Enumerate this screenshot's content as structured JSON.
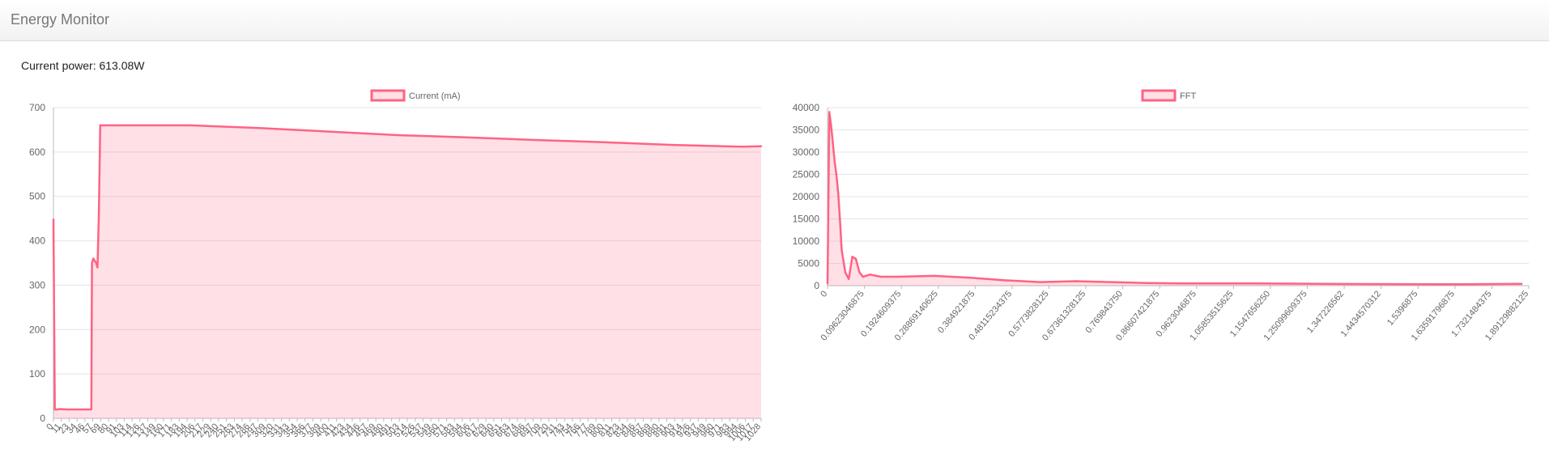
{
  "header": {
    "title": "Energy Monitor"
  },
  "status": {
    "current_power": "Current power: 613.08W"
  },
  "colors": {
    "series": "#ff6384",
    "series_fill": "rgba(255,99,132,0.2)",
    "grid": "#e5e5e5",
    "tick": "#666666"
  },
  "chart_data": [
    {
      "type": "line",
      "legend": "Current (mA)",
      "legend_position": "top",
      "ylim": [
        0,
        700
      ],
      "yticks": [
        0,
        100,
        200,
        300,
        400,
        500,
        600,
        700
      ],
      "xlim": [
        0,
        1028
      ],
      "xticks": [
        "0",
        "11",
        "23",
        "34",
        "46",
        "57",
        "69",
        "80",
        "91",
        "103",
        "114",
        "126",
        "137",
        "149",
        "160",
        "171",
        "183",
        "194",
        "206",
        "217",
        "229",
        "240",
        "251",
        "263",
        "274",
        "286",
        "297",
        "309",
        "320",
        "331",
        "343",
        "354",
        "366",
        "377",
        "389",
        "400",
        "411",
        "423",
        "434",
        "446",
        "457",
        "469",
        "480",
        "491",
        "503",
        "514",
        "526",
        "537",
        "549",
        "560",
        "571",
        "583",
        "594",
        "606",
        "617",
        "629",
        "640",
        "651",
        "663",
        "674",
        "686",
        "697",
        "709",
        "720",
        "731",
        "743",
        "754",
        "766",
        "777",
        "789",
        "800",
        "811",
        "823",
        "834",
        "846",
        "857",
        "869",
        "880",
        "891",
        "903",
        "914",
        "926",
        "937",
        "949",
        "960",
        "971",
        "983",
        "994",
        "1006",
        "1017",
        "1028"
      ],
      "x": [
        0,
        2,
        5,
        10,
        20,
        40,
        55,
        56,
        58,
        62,
        64,
        66,
        68,
        70,
        90,
        200,
        300,
        400,
        500,
        600,
        700,
        800,
        900,
        1000,
        1028
      ],
      "y": [
        448,
        20,
        20,
        21,
        20,
        20,
        20,
        350,
        360,
        350,
        340,
        460,
        660,
        660,
        660,
        660,
        654,
        646,
        638,
        633,
        627,
        622,
        616,
        612,
        613
      ],
      "grid": true
    },
    {
      "type": "line",
      "legend": "FFT",
      "legend_position": "top",
      "ylim": [
        0,
        40000
      ],
      "yticks": [
        0,
        5000,
        10000,
        15000,
        20000,
        25000,
        30000,
        35000,
        40000
      ],
      "xlim": [
        0,
        1.98
      ],
      "xticks": [
        "0",
        "0.09623046875",
        "0.1924609375",
        "0.28869140625",
        "0.384921875",
        "0.48115234375",
        "0.5773828125",
        "0.67361328125",
        "0.769843750",
        "0.86607421875",
        "0.9623046875",
        "1.05853515625",
        "1.1547656250",
        "1.25099609375",
        "1.347226562",
        "1.4434570312",
        "1.5396875",
        "1.63591796875",
        "1.7321484375",
        "1.89129882125"
      ],
      "x": [
        0,
        0.005,
        0.01,
        0.015,
        0.02,
        0.025,
        0.03,
        0.035,
        0.04,
        0.05,
        0.06,
        0.07,
        0.08,
        0.09,
        0.1,
        0.12,
        0.15,
        0.2,
        0.3,
        0.4,
        0.5,
        0.6,
        0.7,
        0.8,
        0.9,
        1.0,
        1.2,
        1.4,
        1.6,
        1.8,
        1.96
      ],
      "y": [
        500,
        39000,
        36000,
        32000,
        28000,
        25000,
        21000,
        15000,
        8000,
        3000,
        1500,
        6500,
        6000,
        3000,
        2000,
        2500,
        2000,
        2000,
        2200,
        1800,
        1200,
        800,
        1000,
        800,
        600,
        500,
        500,
        400,
        350,
        300,
        400
      ],
      "grid": true
    }
  ]
}
